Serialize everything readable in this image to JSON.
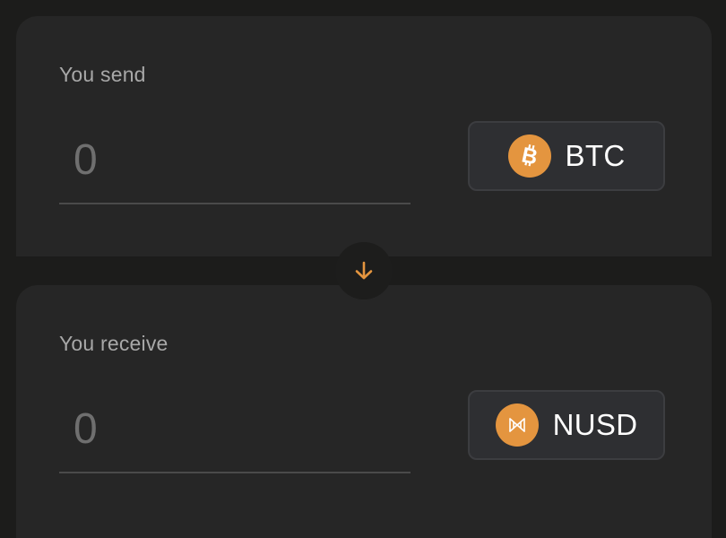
{
  "send": {
    "label": "You send",
    "amount_placeholder": "0",
    "token": {
      "symbol": "BTC",
      "icon": "bitcoin-icon"
    }
  },
  "receive": {
    "label": "You receive",
    "amount_placeholder": "0",
    "token": {
      "symbol": "NUSD",
      "icon": "nusd-icon"
    }
  },
  "swap": {
    "icon": "arrow-down-icon"
  },
  "colors": {
    "background": "#1c1c1b",
    "panel": "#262626",
    "accent": "#e4953f",
    "token_button": "#2e2f32",
    "label": "#a8a8a8",
    "amount": "#6f6f6f"
  }
}
